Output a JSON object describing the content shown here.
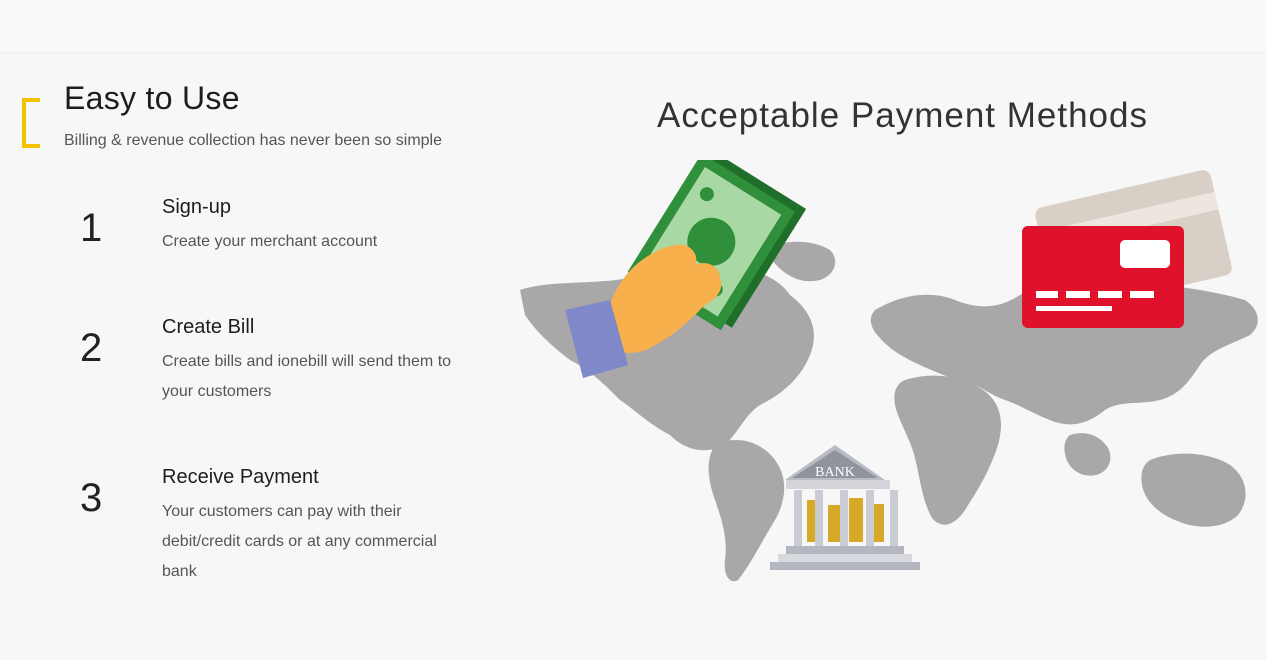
{
  "section": {
    "title": "Easy to Use",
    "subtitle": "Billing & revenue collection has never been so simple"
  },
  "steps": [
    {
      "number": "1",
      "title": "Sign-up",
      "description": "Create your merchant account"
    },
    {
      "number": "2",
      "title": "Create Bill",
      "description": "Create bills and ionebill will send them to your customers"
    },
    {
      "number": "3",
      "title": "Receive Payment",
      "description": "Your customers can pay with their debit/credit cards or at any commercial bank"
    }
  ],
  "illustration": {
    "title": "Acceptable Payment Methods",
    "bank_label": "BANK",
    "colors": {
      "map": "#a9a7a7",
      "card": "#e0112b",
      "cash": "#2f8f3a",
      "hand": "#f8b04c",
      "sleeve": "#7f88c9",
      "accent": "#f2c200"
    }
  }
}
